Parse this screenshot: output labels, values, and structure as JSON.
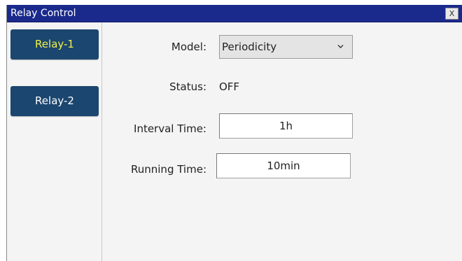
{
  "window": {
    "title": "Relay Control",
    "close_label": "X"
  },
  "sidebar": {
    "items": [
      {
        "label": "Relay-1",
        "active": true
      },
      {
        "label": "Relay-2",
        "active": false
      }
    ]
  },
  "form": {
    "model_label": "Model:",
    "model_value": "Periodicity",
    "status_label": "Status:",
    "status_value": "OFF",
    "interval_label": "Interval Time:",
    "interval_value": "1h",
    "running_label": "Running Time:",
    "running_value": "10min"
  },
  "icons": {
    "close": "close-icon",
    "dropdown": "chevron-down-icon"
  },
  "colors": {
    "titlebar": "#1a2a8c",
    "relay_button": "#1b466f",
    "active_text": "#f1f14a",
    "background": "#f4f4f4"
  }
}
